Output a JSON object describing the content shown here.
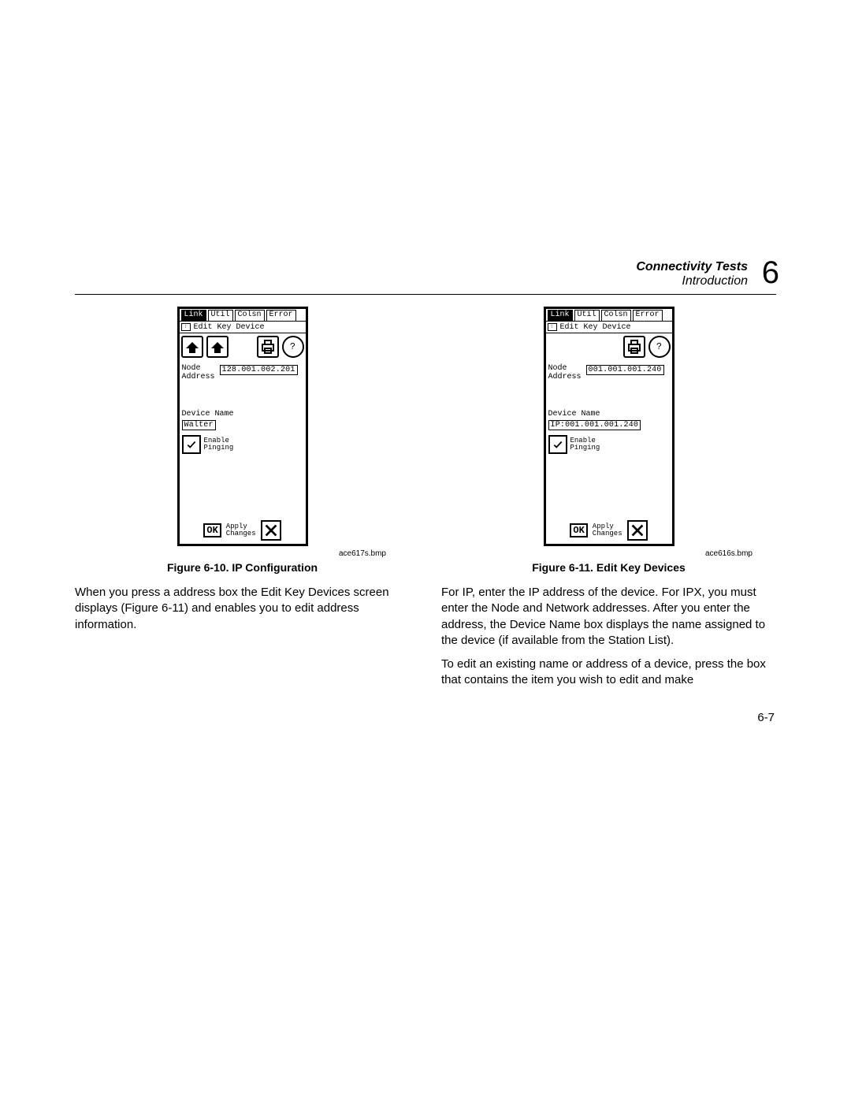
{
  "header": {
    "title": "Connectivity Tests",
    "subtitle": "Introduction",
    "chapter_number": "6"
  },
  "left": {
    "device": {
      "tabs": {
        "link": "Link",
        "util": "Util",
        "colsn": "Colsn",
        "error": "Error"
      },
      "subbar": "Edit Key Device",
      "node_label1": "Node",
      "node_label2": "Address",
      "node_value": "128.001.002.201",
      "devname_label": "Device Name",
      "devname_value": "Walter",
      "enable_l1": "Enable",
      "enable_l2": "Pinging",
      "ok": "OK",
      "apply_l1": "Apply",
      "apply_l2": "Changes",
      "bmp": "ace617s.bmp"
    },
    "caption": "Figure 6-10. IP Configuration",
    "para1": "When you press a address box the Edit Key Devices screen displays (Figure 6-11) and enables you to edit address information."
  },
  "right": {
    "device": {
      "tabs": {
        "link": "Link",
        "util": "Util",
        "colsn": "Colsn",
        "error": "Error"
      },
      "subbar": "Edit Key Device",
      "node_label1": "Node",
      "node_label2": "Address",
      "node_value": "001.001.001.240",
      "devname_label": "Device Name",
      "devname_value": "IP:001.001.001.240",
      "enable_l1": "Enable",
      "enable_l2": "Pinging",
      "ok": "OK",
      "apply_l1": "Apply",
      "apply_l2": "Changes",
      "bmp": "ace616s.bmp"
    },
    "caption": "Figure 6-11. Edit Key Devices",
    "para1": "For IP, enter the IP address of the device. For IPX, you must enter the Node and Network addresses. After you enter the address, the Device Name box displays the name assigned to the device (if available from the Station List).",
    "para2": "To edit an existing name or address of a device, press the box that contains the item you wish to edit and make"
  },
  "page_number": "6-7"
}
